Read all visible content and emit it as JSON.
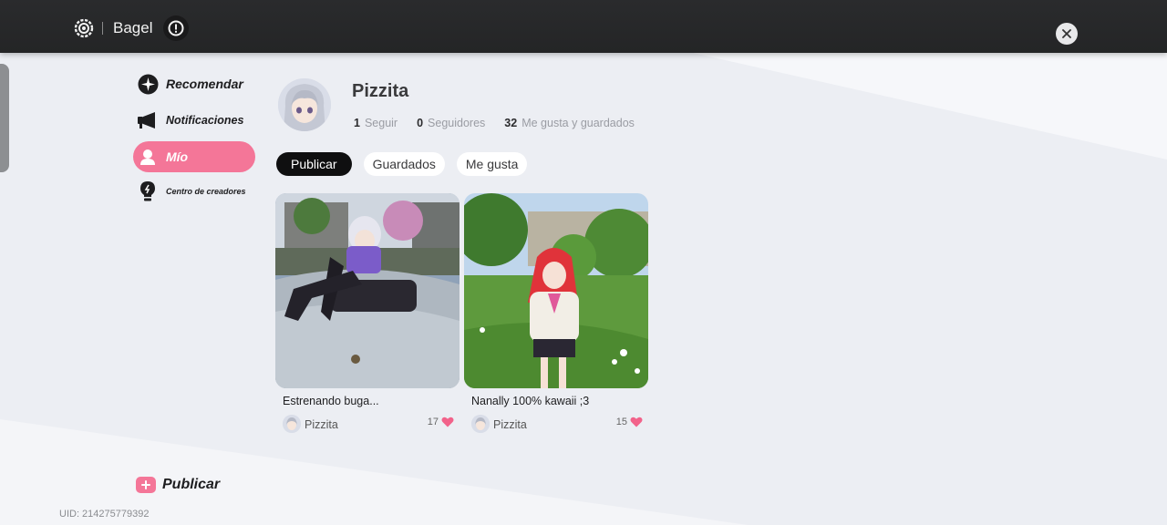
{
  "app": {
    "title": "Bagel"
  },
  "sidebar": {
    "items": [
      {
        "label": "Recomendar",
        "icon": "sparkle-icon",
        "active": false
      },
      {
        "label": "Notificaciones",
        "icon": "megaphone-icon",
        "active": false
      },
      {
        "label": "Mío",
        "icon": "person-icon",
        "active": true
      },
      {
        "label": "Centro de creadores",
        "icon": "lightbulb-icon",
        "active": false
      }
    ],
    "publish_label": "Publicar"
  },
  "profile": {
    "name": "Pizzita",
    "stats": [
      {
        "value": "1",
        "label": "Seguir"
      },
      {
        "value": "0",
        "label": "Seguidores"
      },
      {
        "value": "32",
        "label": "Me gusta y guardados"
      }
    ]
  },
  "tabs": [
    {
      "label": "Publicar",
      "active": true
    },
    {
      "label": "Guardados",
      "active": false
    },
    {
      "label": "Me gusta",
      "active": false
    }
  ],
  "posts": [
    {
      "title": "Estrenando buga...",
      "author": "Pizzita",
      "likes": "17"
    },
    {
      "title": "Nanally 100% kawaii ;3",
      "author": "Pizzita",
      "likes": "15"
    }
  ],
  "footer": {
    "uid": "UID: 214275779392"
  },
  "colors": {
    "accent": "#f47698",
    "topbar": "#262728",
    "background": "#eceef3"
  }
}
